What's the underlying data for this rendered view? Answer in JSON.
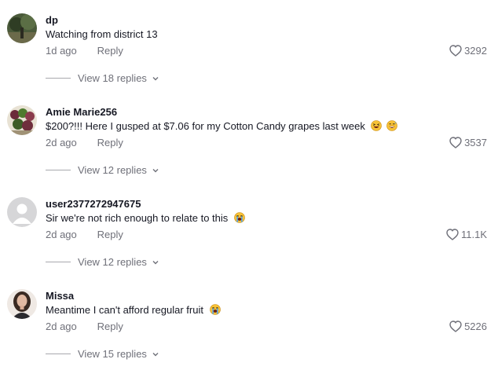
{
  "comments": [
    {
      "username": "dp",
      "text": "Watching from district 13",
      "time": "1d ago",
      "reply_label": "Reply",
      "likes": "3292",
      "view_replies": "View 18 replies",
      "avatar_icon": "avatar-forest-icon"
    },
    {
      "username": "Amie Marie256",
      "text": "$200?!!! Here I gusped at $7.06 for my Cotton Candy grapes last week",
      "time": "2d ago",
      "reply_label": "Reply",
      "likes": "3537",
      "view_replies": "View 12 replies",
      "emojis": [
        "laughing-squint-emoji",
        "grinning-sweat-emoji"
      ],
      "avatar_icon": "avatar-fruit-icon"
    },
    {
      "username": "user2377272947675",
      "text": "Sir we're not rich enough to relate to this",
      "time": "2d ago",
      "reply_label": "Reply",
      "likes": "11.1K",
      "view_replies": "View 12 replies",
      "emojis": [
        "loudly-crying-emoji"
      ],
      "avatar_icon": "default-user-icon"
    },
    {
      "username": "Missa",
      "text": "Meantime I can't afford regular fruit",
      "time": "2d ago",
      "reply_label": "Reply",
      "likes": "5226",
      "view_replies": "View 15 replies",
      "emojis": [
        "loudly-crying-emoji"
      ],
      "avatar_icon": "avatar-person-icon"
    }
  ],
  "colors": {
    "text_primary": "#161823",
    "text_secondary": "#6f7079",
    "emoji_face": "#f7c237"
  }
}
